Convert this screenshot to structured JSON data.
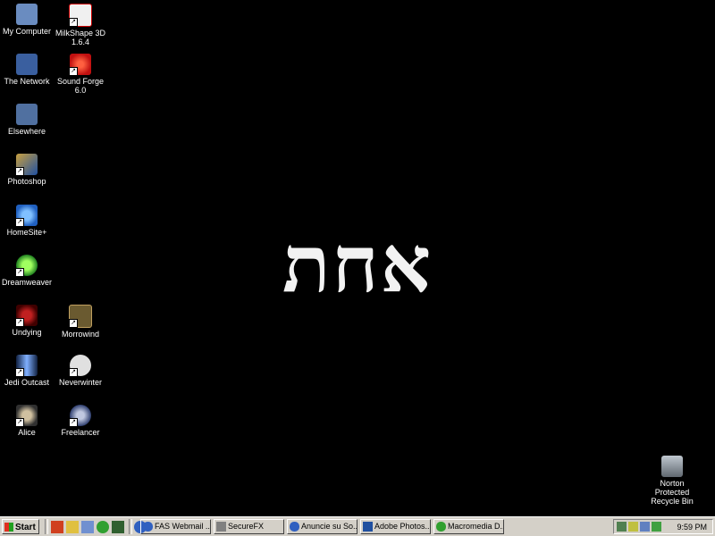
{
  "desktop": {
    "wallpaper_text": "אחת",
    "icons": [
      {
        "label": "My Computer",
        "name": "my-computer-icon"
      },
      {
        "label": "MilkShape 3D 1.6.4",
        "name": "milkshape-icon"
      },
      {
        "label": "The Network",
        "name": "network-icon"
      },
      {
        "label": "Sound Forge 6.0",
        "name": "sound-forge-icon"
      },
      {
        "label": "Elsewhere",
        "name": "elsewhere-icon"
      },
      {
        "label": "Photoshop",
        "name": "photoshop-icon"
      },
      {
        "label": "HomeSite+",
        "name": "homesite-icon"
      },
      {
        "label": "Dreamweaver",
        "name": "dreamweaver-icon"
      },
      {
        "label": "Undying",
        "name": "undying-icon"
      },
      {
        "label": "Morrowind",
        "name": "morrowind-icon"
      },
      {
        "label": "Jedi Outcast",
        "name": "jedi-outcast-icon"
      },
      {
        "label": "Neverwinter",
        "name": "neverwinter-icon"
      },
      {
        "label": "Alice",
        "name": "alice-icon"
      },
      {
        "label": "Freelancer",
        "name": "freelancer-icon"
      },
      {
        "label": "Norton Protected Recycle Bin",
        "name": "recycle-bin-icon"
      }
    ]
  },
  "taskbar": {
    "start_label": "Start",
    "tasks": [
      {
        "label": "FAS Webmail ..."
      },
      {
        "label": "SecureFX"
      },
      {
        "label": "Anuncie su So..."
      },
      {
        "label": "Adobe Photos..."
      },
      {
        "label": "Macromedia D..."
      }
    ],
    "clock": "9:59 PM"
  },
  "colors": {
    "desktop_bg": "#000000",
    "taskbar_bg": "#d4d0c8"
  }
}
